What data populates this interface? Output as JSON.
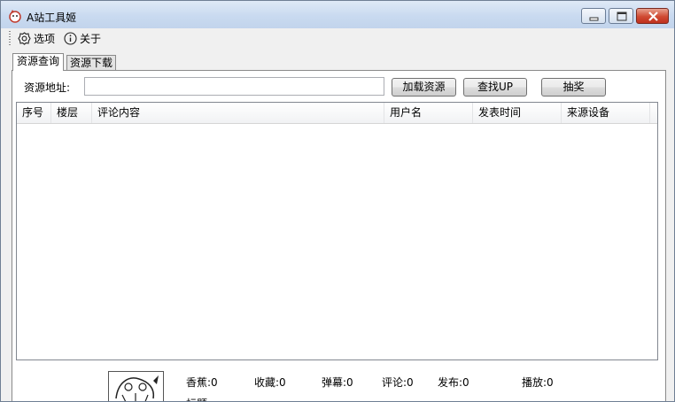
{
  "window": {
    "title": "A站工具姬"
  },
  "menu": {
    "options": "选项",
    "about": "关于"
  },
  "tabs": [
    {
      "label": "资源查询"
    },
    {
      "label": "资源下载"
    }
  ],
  "query": {
    "address_label": "资源地址:",
    "address_value": "",
    "load_button": "加载资源",
    "find_up_button": "查找UP",
    "lottery_button": "抽奖"
  },
  "table": {
    "columns": [
      "序号",
      "楼层",
      "评论内容",
      "用户名",
      "发表时间",
      "来源设备"
    ],
    "rows": []
  },
  "stats": {
    "banana": "香蕉:0",
    "favorites": "收藏:0",
    "danmaku": "弹幕:0",
    "comments": "评论:0",
    "published": "发布:0",
    "plays": "播放:0",
    "title_label": "标题"
  },
  "icons": {
    "options": "gear-icon",
    "about": "info-icon"
  }
}
